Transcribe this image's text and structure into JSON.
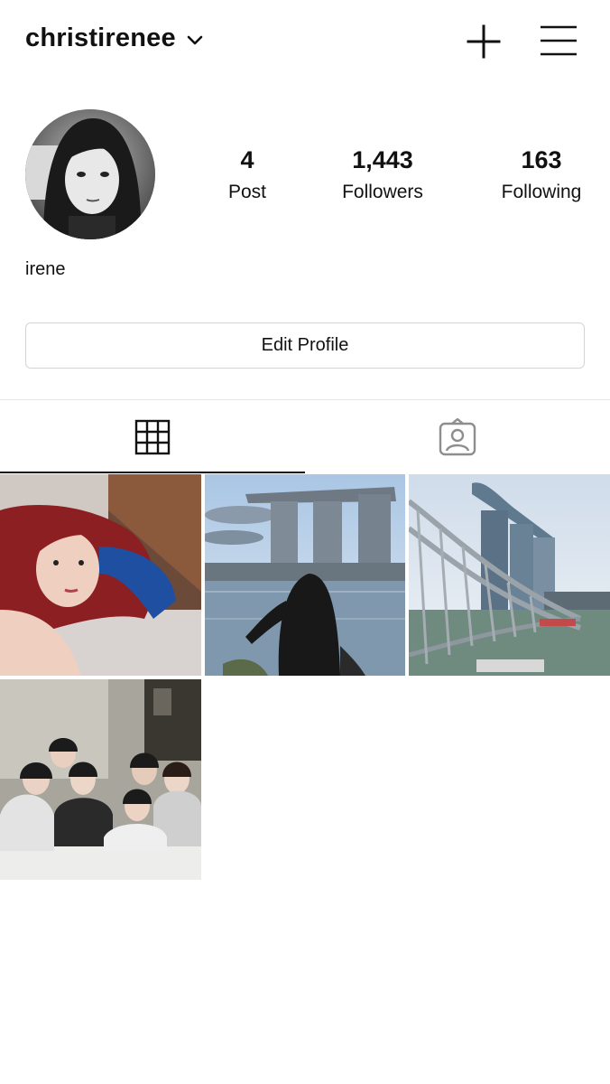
{
  "header": {
    "username": "christirenee"
  },
  "profile": {
    "display_name": "irene",
    "stats": [
      {
        "value": "4",
        "label": "Post"
      },
      {
        "value": "1,443",
        "label": "Followers"
      },
      {
        "value": "163",
        "label": "Following"
      }
    ],
    "edit_button_label": "Edit Profile"
  },
  "tabs": [
    {
      "name": "grid",
      "icon": "grid-icon",
      "active": true
    },
    {
      "name": "tagged",
      "icon": "tagged-person-icon",
      "active": false
    }
  ],
  "posts": [
    {
      "description": "selfie with red hair"
    },
    {
      "description": "woman facing Marina Bay Sands"
    },
    {
      "description": "Helix bridge and Marina Bay Sands"
    },
    {
      "description": "group photo of friends on bed"
    }
  ],
  "colors": {
    "text": "#111111",
    "border": "#d4d4d4",
    "divider": "#e6e6e6",
    "tagged_icon": "#8e8e8e"
  }
}
